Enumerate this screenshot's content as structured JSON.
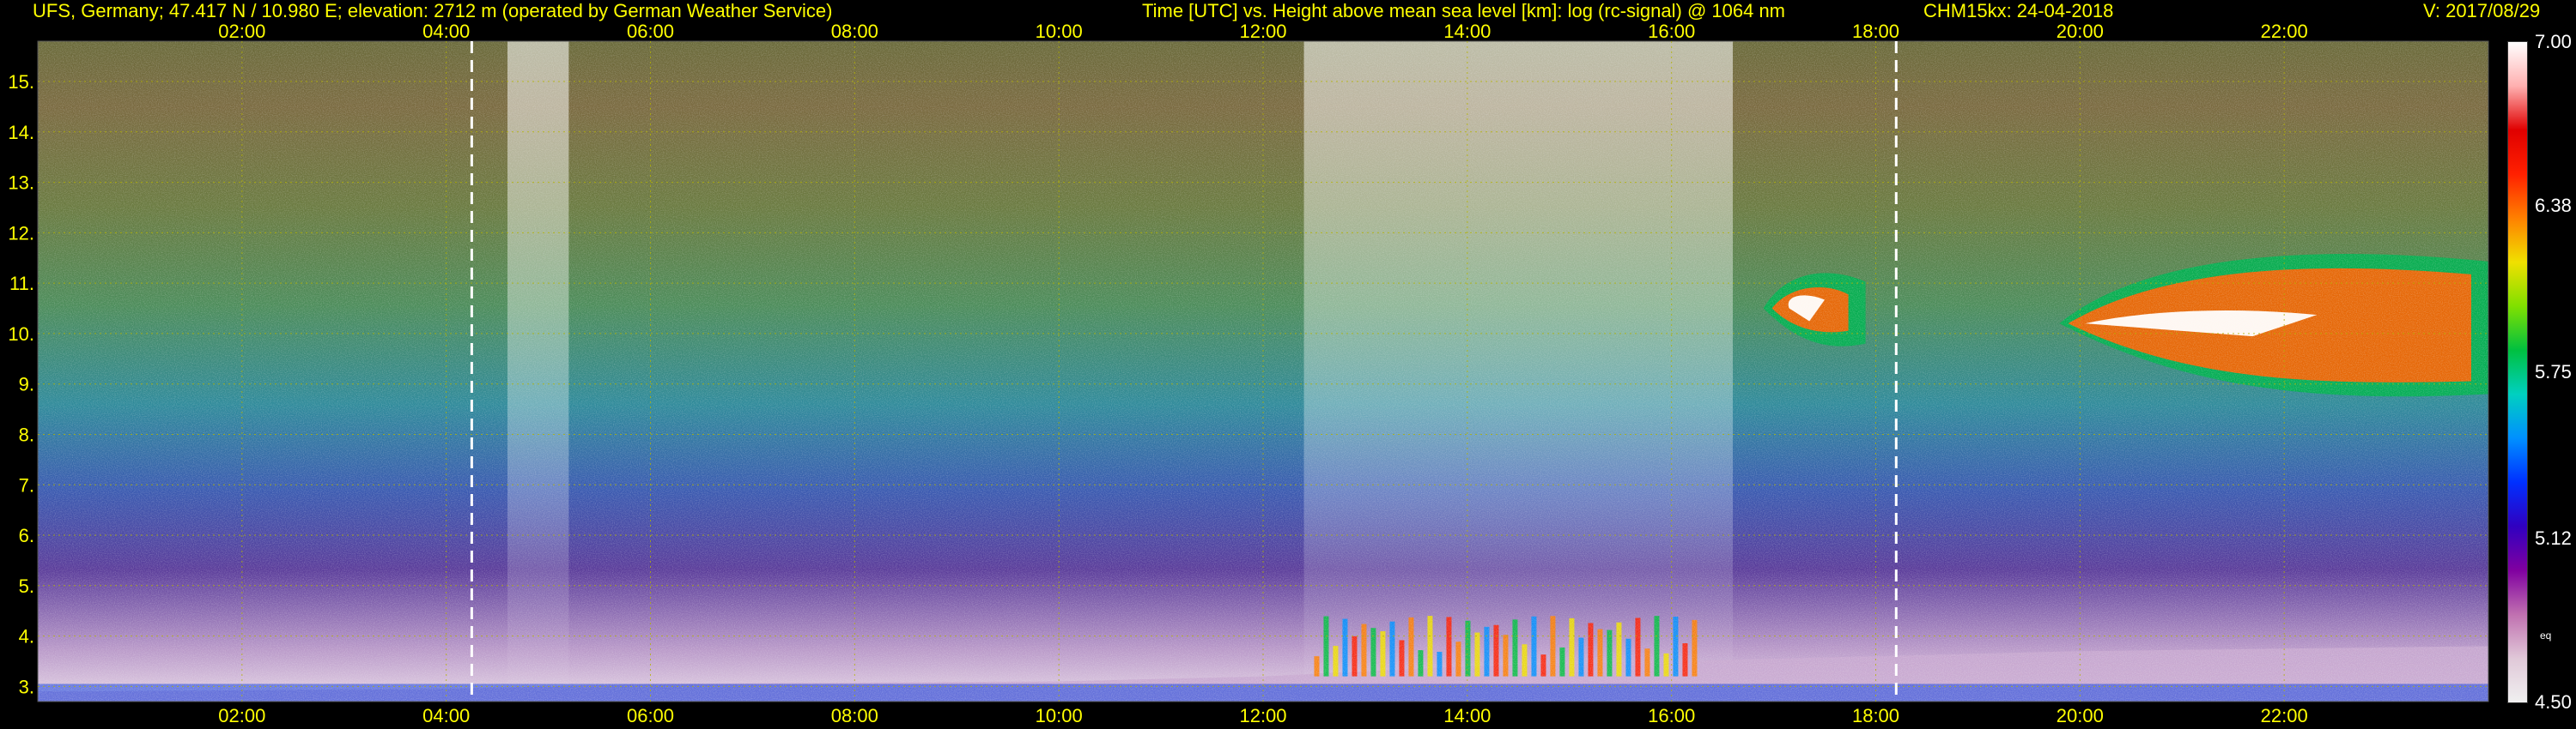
{
  "header": {
    "station": "UFS, Germany; 47.417 N / 10.980 E; elevation: 2712 m  (operated by German Weather Service)",
    "description": "Time [UTC] vs. Height above mean sea level [km]: log (rc-signal) @ 1064 nm",
    "instrument": "CHM15kx: 24-04-2018",
    "version": "V: 2017/08/29"
  },
  "colors": {
    "header_text": "#ffff00",
    "tick_text": "#ffff00",
    "background": "#000000",
    "grid": "#b4b400",
    "marker_line": "#ffffff",
    "legend_text": "#ffffff"
  },
  "chart_data": {
    "type": "heatmap",
    "title": "log (rc-signal) @ 1064 nm",
    "xlabel": "Time [UTC]",
    "ylabel": "Height above mean sea level [km]",
    "x_ticks": [
      "02:00",
      "04:00",
      "06:00",
      "08:00",
      "10:00",
      "12:00",
      "14:00",
      "16:00",
      "18:00",
      "20:00",
      "22:00"
    ],
    "x_tick_hours": [
      2,
      4,
      6,
      8,
      10,
      12,
      14,
      16,
      18,
      20,
      22
    ],
    "xlim_hours": [
      0,
      24
    ],
    "y_ticks": [
      "3.",
      "4.",
      "5.",
      "6.",
      "7.",
      "8.",
      "9.",
      "10.",
      "11.",
      "12.",
      "13.",
      "14.",
      "15."
    ],
    "y_tick_values": [
      3,
      4,
      5,
      6,
      7,
      8,
      9,
      10,
      11,
      12,
      13,
      14,
      15
    ],
    "ylim_km": [
      2.7,
      15.8
    ],
    "grid": true,
    "vertical_markers_hours": [
      4.25,
      18.2
    ],
    "colorbar": {
      "ticks": [
        "7.00",
        "6.38",
        "5.75",
        "5.12",
        "4.50"
      ],
      "tick_values": [
        7.0,
        6.38,
        5.75,
        5.12,
        4.5
      ],
      "range": [
        4.5,
        7.0
      ],
      "small_label": "eq",
      "colors": [
        "#f0f0f0",
        "#e0c8d8",
        "#c070b0",
        "#8000a0",
        "#3000c0",
        "#0030ff",
        "#0090ff",
        "#00d0c0",
        "#00c040",
        "#80e000",
        "#f0e000",
        "#ff8000",
        "#ff2000",
        "#e00000",
        "#ffb0b0",
        "#ffffff"
      ]
    },
    "features": {
      "boundary_layer_top_km": [
        [
          0,
          2.9
        ],
        [
          4,
          2.95
        ],
        [
          6,
          3.05
        ],
        [
          10,
          3.1
        ],
        [
          12,
          3.2
        ],
        [
          14,
          3.4
        ],
        [
          16,
          3.5
        ],
        [
          18,
          3.6
        ],
        [
          20,
          3.7
        ],
        [
          22,
          3.75
        ],
        [
          24,
          3.8
        ]
      ],
      "cirrus_layers": [
        {
          "start_hour": 16.9,
          "end_hour": 17.9,
          "base_km": 9.8,
          "top_km": 11.2
        },
        {
          "start_hour": 19.8,
          "end_hour": 24.0,
          "base_km": 8.8,
          "top_km": 11.6
        }
      ],
      "convective_plumes_hours": [
        12.5,
        16.2
      ],
      "high_signal_columns_hours": [
        [
          4.6,
          5.2
        ],
        [
          12.4,
          16.6
        ]
      ]
    }
  }
}
